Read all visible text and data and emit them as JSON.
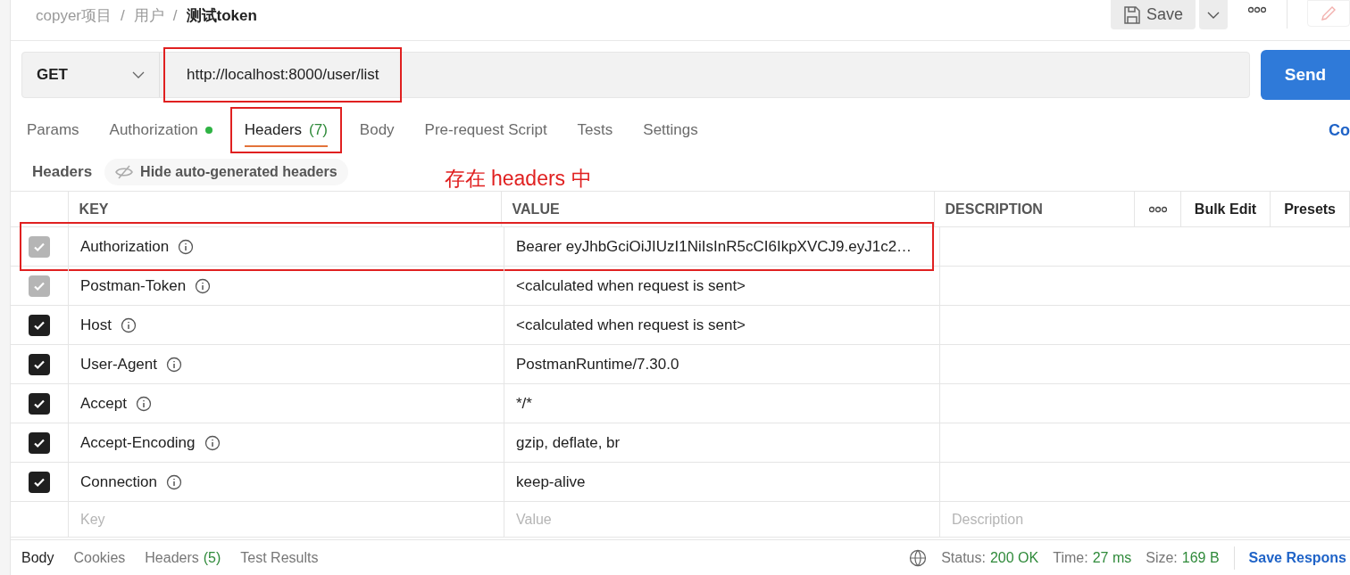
{
  "breadcrumb": {
    "separator": "/",
    "items": [
      {
        "text": "copyer项目",
        "current": false
      },
      {
        "text": "用户",
        "current": false
      },
      {
        "text": "测试token",
        "current": true
      }
    ]
  },
  "toolbar": {
    "save": "Save"
  },
  "request": {
    "method": "GET",
    "url": "http://localhost:8000/user/list",
    "url_highlighted": true,
    "send": "Send"
  },
  "tabs": [
    {
      "label": "Params",
      "selected": false,
      "indicator": false,
      "highlighted": false
    },
    {
      "label": "Authorization",
      "selected": false,
      "indicator": true,
      "highlighted": false
    },
    {
      "label": "Headers",
      "count": "(7)",
      "selected": true,
      "indicator": false,
      "highlighted": true
    },
    {
      "label": "Body",
      "selected": false,
      "indicator": false,
      "highlighted": false
    },
    {
      "label": "Pre-request Script",
      "selected": false,
      "indicator": false,
      "highlighted": false
    },
    {
      "label": "Tests",
      "selected": false,
      "indicator": false,
      "highlighted": false
    },
    {
      "label": "Settings",
      "selected": false,
      "indicator": false,
      "highlighted": false
    }
  ],
  "code_link": "Co",
  "headers_bar": {
    "title": "Headers",
    "toggle": "Hide auto-generated headers"
  },
  "annotation": "存在 headers 中",
  "table": {
    "columns": [
      "KEY",
      "VALUE",
      "DESCRIPTION"
    ],
    "actions": [
      "Bulk Edit",
      "Presets"
    ],
    "rows": [
      {
        "key": "Authorization",
        "value": "Bearer eyJhbGciOiJIUzI1NiIsInR5cCI6IkpXVCJ9.eyJ1c2…",
        "checked": true,
        "disabled": true,
        "highlighted": true
      },
      {
        "key": "Postman-Token",
        "value": "<calculated when request is sent>",
        "checked": true,
        "disabled": true,
        "highlighted": false
      },
      {
        "key": "Host",
        "value": "<calculated when request is sent>",
        "checked": true,
        "disabled": false,
        "highlighted": false
      },
      {
        "key": "User-Agent",
        "value": "PostmanRuntime/7.30.0",
        "checked": true,
        "disabled": false,
        "highlighted": false
      },
      {
        "key": "Accept",
        "value": "*/*",
        "checked": true,
        "disabled": false,
        "highlighted": false
      },
      {
        "key": "Accept-Encoding",
        "value": "gzip, deflate, br",
        "checked": true,
        "disabled": false,
        "highlighted": false
      },
      {
        "key": "Connection",
        "value": "keep-alive",
        "checked": true,
        "disabled": false,
        "highlighted": false
      }
    ],
    "new_row": {
      "key_placeholder": "Key",
      "value_placeholder": "Value",
      "description_placeholder": "Description"
    }
  },
  "response_bar": {
    "tabs": [
      {
        "label": "Body",
        "selected": true
      },
      {
        "label": "Cookies",
        "selected": false
      },
      {
        "label": "Headers",
        "count": "(5)",
        "selected": false
      },
      {
        "label": "Test Results",
        "selected": false
      }
    ],
    "status": [
      {
        "label": "Status:",
        "value": "200 OK"
      },
      {
        "label": "Time:",
        "value": "27 ms"
      },
      {
        "label": "Size:",
        "value": "169 B"
      }
    ],
    "save_response": "Save Respons"
  }
}
